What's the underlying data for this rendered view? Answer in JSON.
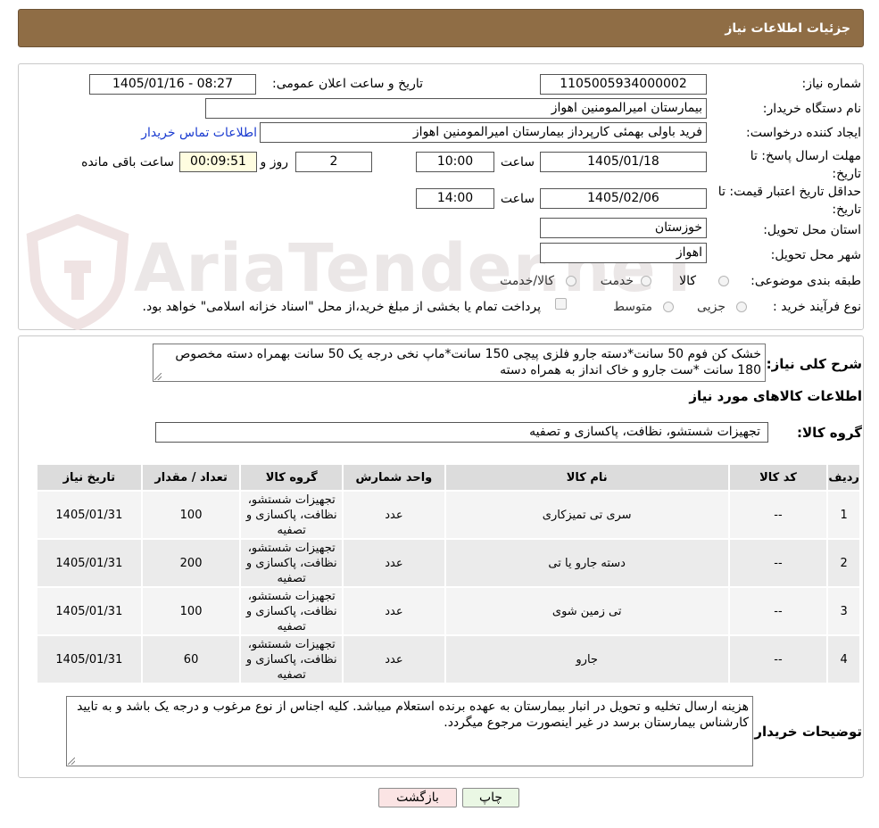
{
  "header": {
    "title": "جزئیات اطلاعات نیاز"
  },
  "watermark": {
    "text": "AriaTender.neT"
  },
  "form": {
    "need_number_label": "شماره نیاز:",
    "need_number": "1105005934000002",
    "announce_label": "تاریخ و ساعت اعلان عمومی:",
    "announce_value": "1405/01/16 - 08:27",
    "buyer_org_label": "نام دستگاه خریدار:",
    "buyer_org": "بیمارستان امیرالمومنین اهواز",
    "requester_label": "ایجاد کننده درخواست:",
    "requester": "فرید باولی بهمئی کارپرداز بیمارستان امیرالمومنین اهواز",
    "contact_link": "اطلاعات تماس خریدار",
    "deadline_label": "مهلت ارسال پاسخ: تا تاریخ:",
    "deadline_date": "1405/01/18",
    "time_label": "ساعت",
    "deadline_time": "10:00",
    "days_value": "2",
    "days_label": "روز و",
    "remaining_value": "00:09:51",
    "remaining_label": "ساعت باقی مانده",
    "validity_label": "حداقل تاریخ اعتبار قیمت: تا تاریخ:",
    "validity_date": "1405/02/06",
    "validity_time": "14:00",
    "province_label": "استان محل تحویل:",
    "province": "خوزستان",
    "city_label": "شهر محل تحویل:",
    "city": "اهواز",
    "category_label": "طبقه بندی موضوعی:",
    "category_options": [
      "کالا",
      "خدمت",
      "کالا/خدمت"
    ],
    "process_label": "نوع فرآیند خرید :",
    "process_options": [
      "جزیی",
      "متوسط"
    ],
    "payment_note": "پرداخت تمام یا بخشی از مبلغ خرید،از محل \"اسناد خزانه اسلامی\" خواهد بود."
  },
  "summary": {
    "label": "شرح کلی نیاز:",
    "text": "خشک کن فوم 50 سانت*دسته جارو فلزی پیچی 150 سانت*ماپ نخی درجه یک 50 سانت بهمراه دسته مخصوص 180 سانت *ست جارو و خاک انداز به همراه دسته"
  },
  "goods": {
    "section_title": "اطلاعات کالاهای مورد نیاز",
    "group_label": "گروه کالا:",
    "group_value": "تجهیزات شستشو، نظافت، پاکسازی و تصفیه",
    "columns": [
      "ردیف",
      "کد کالا",
      "نام کالا",
      "واحد شمارش",
      "گروه کالا",
      "تعداد / مقدار",
      "تاریخ نیاز"
    ],
    "rows": [
      {
        "row": "1",
        "code": "--",
        "name": "سری تی تمیزکاری",
        "unit": "عدد",
        "group": "تجهیزات شستشو، نظافت، پاکسازی و تصفیه",
        "qty": "100",
        "date": "1405/01/31"
      },
      {
        "row": "2",
        "code": "--",
        "name": "دسته جارو یا تی",
        "unit": "عدد",
        "group": "تجهیزات شستشو، نظافت، پاکسازی و تصفیه",
        "qty": "200",
        "date": "1405/01/31"
      },
      {
        "row": "3",
        "code": "--",
        "name": "تی زمین شوی",
        "unit": "عدد",
        "group": "تجهیزات شستشو، نظافت، پاکسازی و تصفیه",
        "qty": "100",
        "date": "1405/01/31"
      },
      {
        "row": "4",
        "code": "--",
        "name": "جارو",
        "unit": "عدد",
        "group": "تجهیزات شستشو، نظافت، پاکسازی و تصفیه",
        "qty": "60",
        "date": "1405/01/31"
      }
    ]
  },
  "notes": {
    "label": "توضیحات خریدار:",
    "text": "هزینه ارسال تخلیه و تحویل در انبار بیمارستان به عهده برنده استعلام میباشد. کلیه اجناس از نوع مرغوب و درجه یک باشد و به تایید کارشناس بیمارستان برسد در غیر اینصورت مرجوع میگردد."
  },
  "buttons": {
    "print": "چاپ",
    "back": "بازگشت"
  },
  "colors": {
    "header_bg": "#8f6d45",
    "print_bg": "#eaf7e4",
    "back_bg": "#fbe4e4",
    "link": "#1a3bd0"
  }
}
